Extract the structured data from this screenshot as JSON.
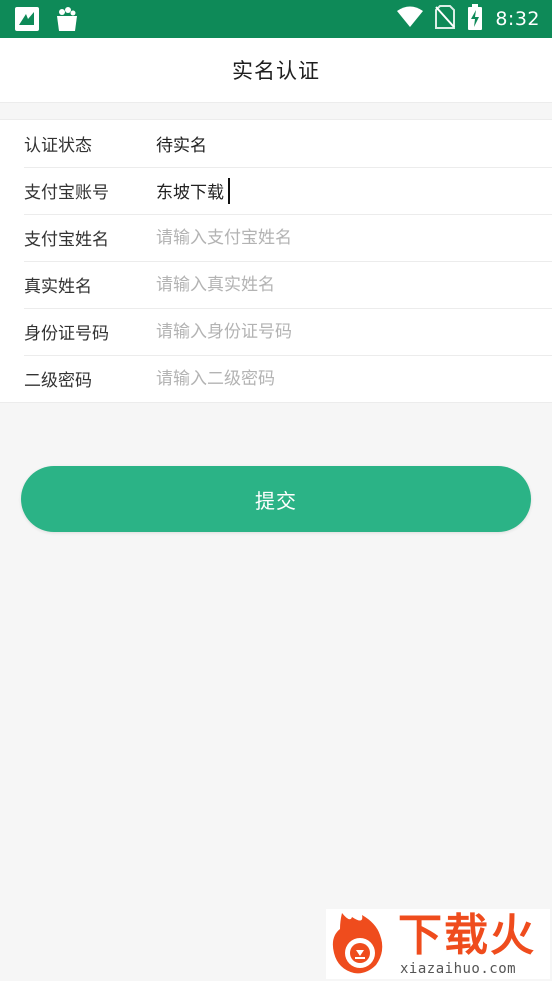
{
  "status_bar": {
    "time": "8:32",
    "left_icons": [
      "app-notification-icon",
      "shopping-bag-icon"
    ],
    "right_icons": [
      "wifi-icon",
      "no-sim-icon",
      "battery-charging-icon"
    ]
  },
  "header": {
    "title": "实名认证"
  },
  "form": {
    "status": {
      "label": "认证状态",
      "value": "待实名"
    },
    "alipay_account": {
      "label": "支付宝账号",
      "value": "东坡下载"
    },
    "alipay_name": {
      "label": "支付宝姓名",
      "placeholder": "请输入支付宝姓名"
    },
    "real_name": {
      "label": "真实姓名",
      "placeholder": "请输入真实姓名"
    },
    "id_number": {
      "label": "身份证号码",
      "placeholder": "请输入身份证号码"
    },
    "second_password": {
      "label": "二级密码",
      "placeholder": "请输入二级密码"
    }
  },
  "submit": {
    "label": "提交"
  },
  "watermark": {
    "name": "下载火",
    "domain": "xiazaihuo.com"
  },
  "colors": {
    "status_bar": "#0e8a58",
    "accent": "#2bb386",
    "background": "#f6f6f6",
    "watermark": "#ef4c1d"
  }
}
